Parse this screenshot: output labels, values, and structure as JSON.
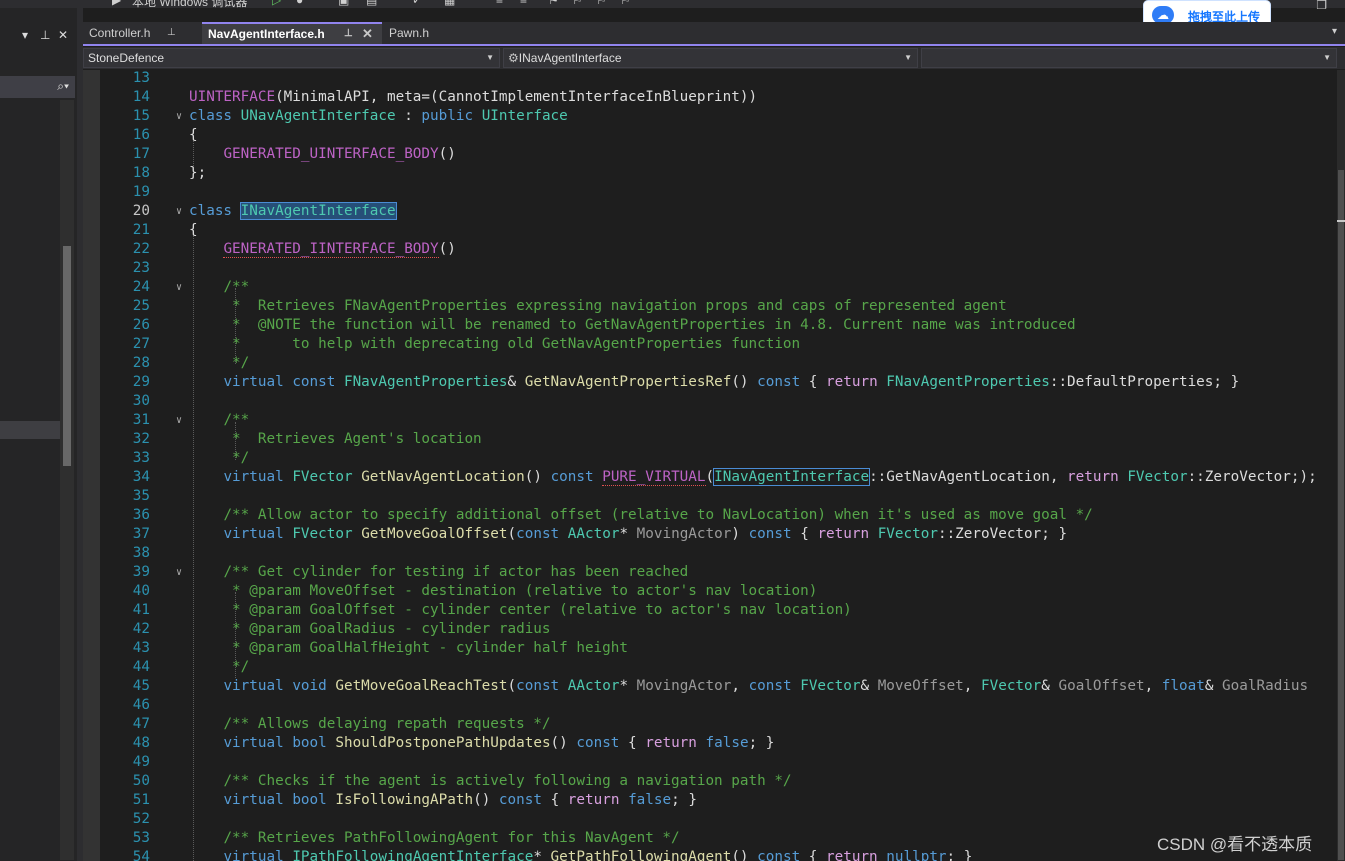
{
  "toolbar": {
    "config_label": "本地 Windows 调试器"
  },
  "upload": {
    "label": "拖拽至此上传",
    "icon": "cloud-icon"
  },
  "tabs": [
    {
      "label": "Controller.h",
      "active": false
    },
    {
      "label": "NavAgentInterface.h",
      "active": true
    },
    {
      "label": "Pawn.h",
      "active": false
    }
  ],
  "nav": {
    "project": "StoneDefence",
    "scope": "INavAgentInterface",
    "member": ""
  },
  "lines": [
    {
      "n": "13",
      "html": ""
    },
    {
      "n": "14",
      "html": "<span class='ma'>UINTERFACE</span>(MinimalAPI, meta=(CannotImplementInterfaceInBlueprint))"
    },
    {
      "n": "15",
      "fold": "v",
      "html": "<span class='kw'>class</span> <span class='ty'>UNavAgentInterface</span> : <span class='kw'>public</span> <span class='ty'>UInterface</span>"
    },
    {
      "n": "16",
      "html": "{"
    },
    {
      "n": "17",
      "html": "    <span class='ma'>GENERATED_UINTERFACE_BODY</span>()"
    },
    {
      "n": "18",
      "html": "};"
    },
    {
      "n": "19",
      "html": ""
    },
    {
      "n": "20",
      "fold": "v",
      "cur": true,
      "html": "<span class='kw'>class</span> <span class='ty hl'>INavAgentInterface</span>"
    },
    {
      "n": "21",
      "html": "{"
    },
    {
      "n": "22",
      "html": "    <span class='ma squig'>GENERATED_IINTERFACE_BODY</span>()"
    },
    {
      "n": "23",
      "html": ""
    },
    {
      "n": "24",
      "fold": "v",
      "html": "    <span class='cm'>/**</span>"
    },
    {
      "n": "25",
      "html": "    <span class='cm'> *  Retrieves FNavAgentProperties expressing navigation props and caps of represented agent</span>"
    },
    {
      "n": "26",
      "html": "    <span class='cm'> *  @NOTE the function will be renamed to GetNavAgentProperties in 4.8. Current name was introduced</span>"
    },
    {
      "n": "27",
      "html": "    <span class='cm'> *      to help with deprecating old GetNavAgentProperties function</span>"
    },
    {
      "n": "28",
      "html": "    <span class='cm'> */</span>"
    },
    {
      "n": "29",
      "html": "    <span class='kw'>virtual</span> <span class='kw'>const</span> <span class='ty'>FNavAgentProperties</span>&amp; <span class='fn'>GetNavAgentPropertiesRef</span>() <span class='kw'>const</span> { <span class='ctl'>return</span> <span class='ty'>FNavAgentProperties</span>::DefaultProperties; }"
    },
    {
      "n": "30",
      "html": ""
    },
    {
      "n": "31",
      "fold": "v",
      "html": "    <span class='cm'>/**</span>"
    },
    {
      "n": "32",
      "html": "    <span class='cm'> *  Retrieves Agent's location</span>"
    },
    {
      "n": "33",
      "html": "    <span class='cm'> */</span>"
    },
    {
      "n": "34",
      "html": "    <span class='kw'>virtual</span> <span class='ty'>FVector</span> <span class='fn'>GetNavAgentLocation</span>() <span class='kw'>const</span> <span class='ma squig'>PURE_VIRTUAL</span>(<span class='ty hl2'>INavAgentInterface</span>::GetNavAgentLocation, <span class='ctl'>return</span> <span class='ty'>FVector</span>::ZeroVector;);"
    },
    {
      "n": "35",
      "html": ""
    },
    {
      "n": "36",
      "html": "    <span class='cm'>/** Allow actor to specify additional offset (relative to NavLocation) when it's used as move goal */</span>"
    },
    {
      "n": "37",
      "html": "    <span class='kw'>virtual</span> <span class='ty'>FVector</span> <span class='fn'>GetMoveGoalOffset</span>(<span class='kw'>const</span> <span class='ty'>AActor</span>* <span class='pa'>MovingActor</span>) <span class='kw'>const</span> { <span class='ctl'>return</span> <span class='ty'>FVector</span>::ZeroVector; }"
    },
    {
      "n": "38",
      "html": ""
    },
    {
      "n": "39",
      "fold": "v",
      "html": "    <span class='cm'>/** Get cylinder for testing if actor has been reached</span>"
    },
    {
      "n": "40",
      "html": "    <span class='cm'> * @param MoveOffset - destination (relative to actor's nav location)</span>"
    },
    {
      "n": "41",
      "html": "    <span class='cm'> * @param GoalOffset - cylinder center (relative to actor's nav location)</span>"
    },
    {
      "n": "42",
      "html": "    <span class='cm'> * @param GoalRadius - cylinder radius</span>"
    },
    {
      "n": "43",
      "html": "    <span class='cm'> * @param GoalHalfHeight - cylinder half height</span>"
    },
    {
      "n": "44",
      "html": "    <span class='cm'> */</span>"
    },
    {
      "n": "45",
      "html": "    <span class='kw'>virtual</span> <span class='kw'>void</span> <span class='fn'>GetMoveGoalReachTest</span>(<span class='kw'>const</span> <span class='ty'>AActor</span>* <span class='pa'>MovingActor</span>, <span class='kw'>const</span> <span class='ty'>FVector</span>&amp; <span class='pa'>MoveOffset</span>, <span class='ty'>FVector</span>&amp; <span class='pa'>GoalOffset</span>, <span class='kw'>float</span>&amp; <span class='pa'>GoalRadius</span>"
    },
    {
      "n": "46",
      "html": ""
    },
    {
      "n": "47",
      "html": "    <span class='cm'>/** Allows delaying repath requests */</span>"
    },
    {
      "n": "48",
      "html": "    <span class='kw'>virtual</span> <span class='kw'>bool</span> <span class='fn'>ShouldPostponePathUpdates</span>() <span class='kw'>const</span> { <span class='ctl'>return</span> <span class='kw'>false</span>; }"
    },
    {
      "n": "49",
      "html": ""
    },
    {
      "n": "50",
      "html": "    <span class='cm'>/** Checks if the agent is actively following a navigation path */</span>"
    },
    {
      "n": "51",
      "html": "    <span class='kw'>virtual</span> <span class='kw'>bool</span> <span class='fn'>IsFollowingAPath</span>() <span class='kw'>const</span> { <span class='ctl'>return</span> <span class='kw'>false</span>; }"
    },
    {
      "n": "52",
      "html": ""
    },
    {
      "n": "53",
      "html": "    <span class='cm'>/** Retrieves PathFollowingAgent for this NavAgent */</span>"
    },
    {
      "n": "54",
      "html": "    <span class='kw'>virtual</span> <span class='ty'>IPathFollowingAgentInterface</span>* <span class='fn'>GetPathFollowingAgent</span>() <span class='kw'>const</span> { <span class='ctl'>return</span> <span class='kw'>nullptr</span>; }"
    }
  ],
  "watermark": "CSDN @看不透本质"
}
